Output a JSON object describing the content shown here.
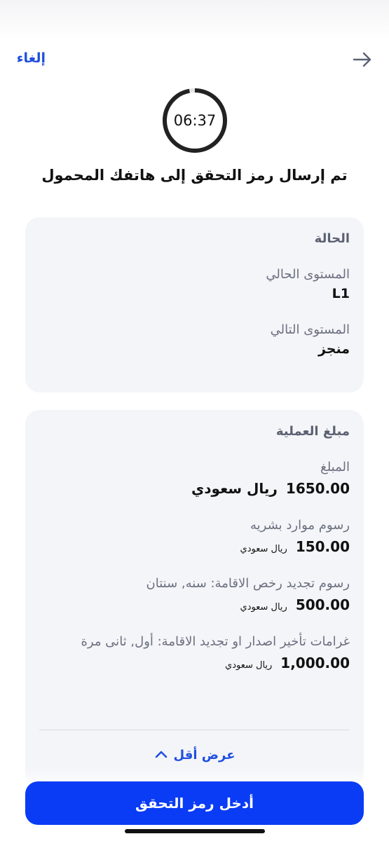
{
  "nav": {
    "cancel_label": "إلغاء"
  },
  "timer": {
    "countdown": "06:37",
    "progress": 0.97
  },
  "otp_message": "تم إرسال رمز التحقق إلى هاتفك المحمول",
  "status_card": {
    "title": "الحالة",
    "current_level_label": "المستوى الحالي",
    "current_level_value": "L1",
    "next_level_label": "المستوى التالي",
    "next_level_value": "منجز"
  },
  "amount_card": {
    "title": "مبلغ العملية",
    "amount_label": "المبلغ",
    "amount_value": "1650.00",
    "amount_currency": "ريال سعودي",
    "hr_fee_label": "رسوم موارد بشريه",
    "hr_fee_value": "150.00",
    "hr_fee_currency": "ريال سعودي",
    "residency_fee_label": "رسوم تجديد رخص الاقامة:  سنه, سنتان",
    "residency_fee_value": "500.00",
    "residency_fee_currency": "ريال سعودي",
    "penalty_label": "غرامات تأخير اصدار او تجديد الاقامة: أول, ثانى مرة",
    "penalty_value": "1,000.00",
    "penalty_currency": "ريال سعودي",
    "show_less_label": "عرض أقل"
  },
  "cta": {
    "label": "أدخل رمز التحقق"
  },
  "colors": {
    "accent": "#0a3cf5",
    "link": "#1f4fe0",
    "card_bg": "#f4f5f8"
  },
  "icons": {
    "back": "arrow-right-icon",
    "show_less": "chevron-up-icon"
  }
}
